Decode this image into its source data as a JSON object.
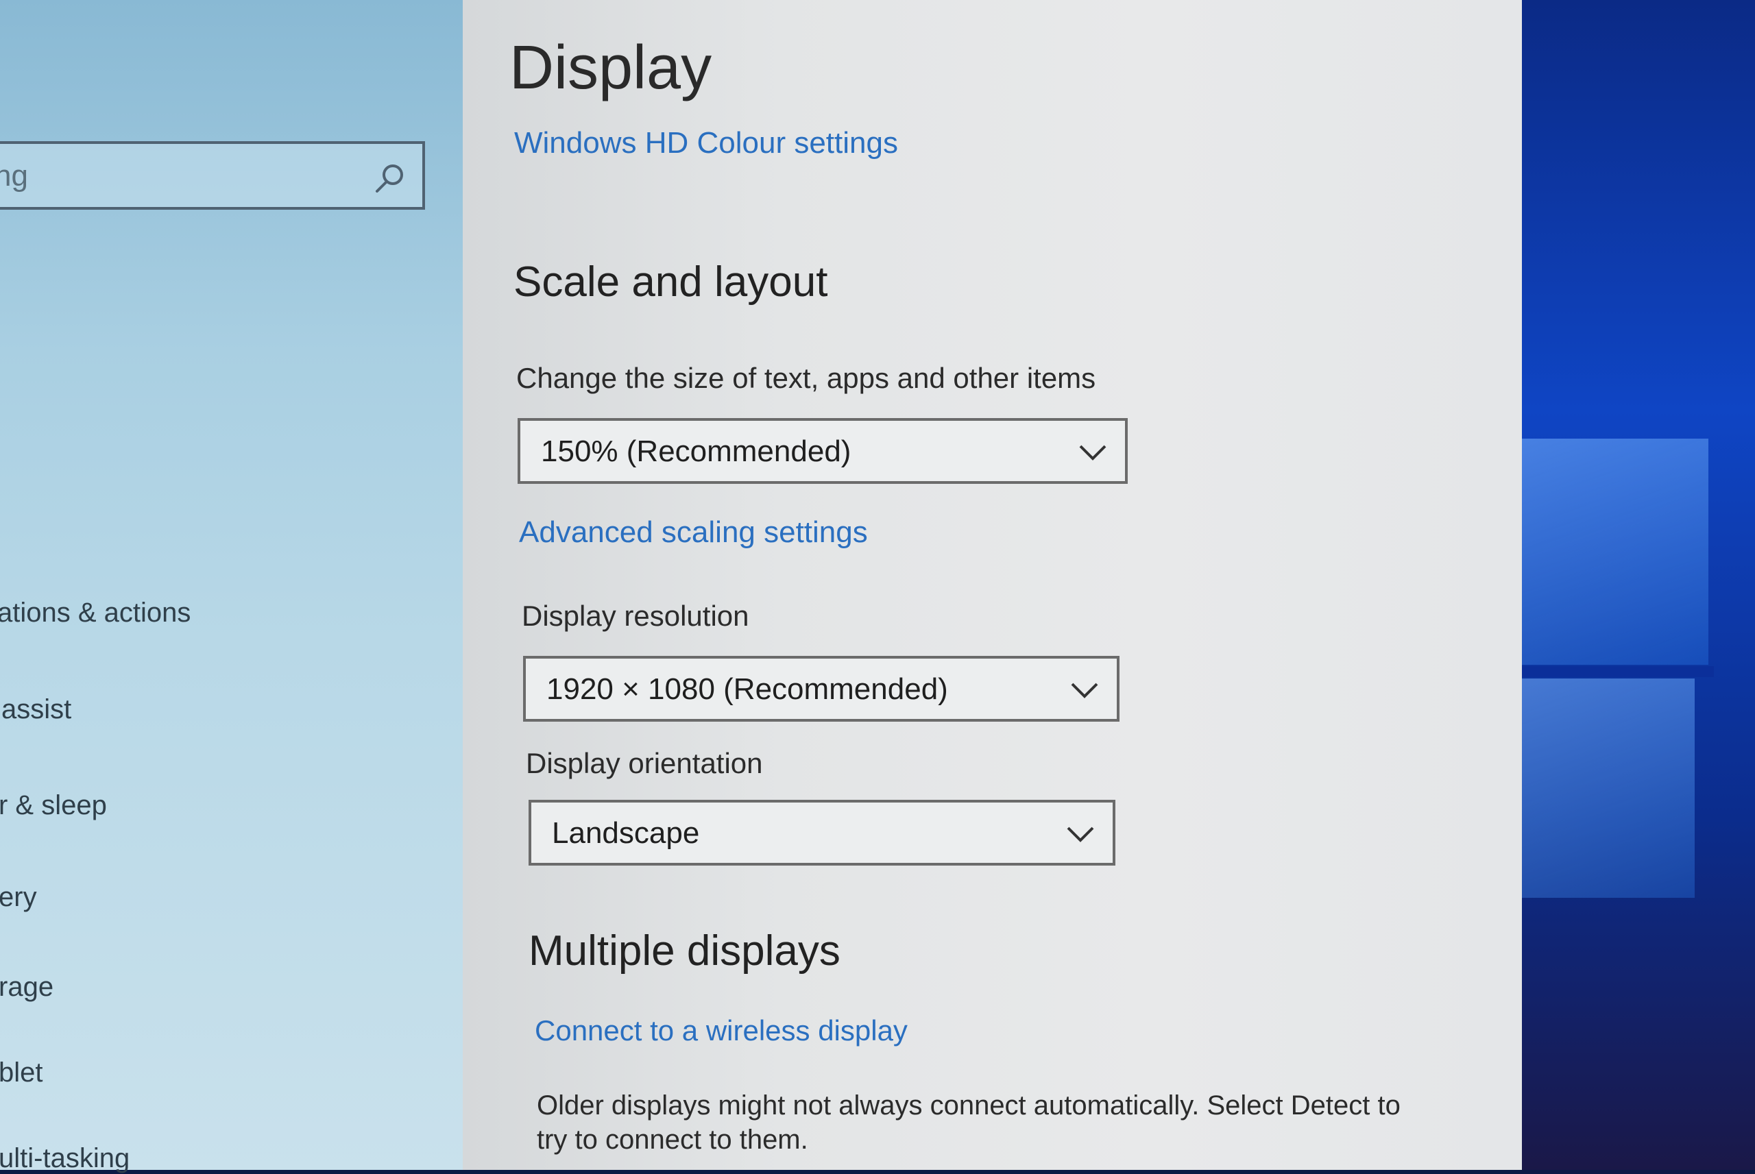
{
  "sidebar": {
    "search": {
      "value": "ng"
    },
    "items": [
      {
        "label": "ations & actions"
      },
      {
        "label": " assist"
      },
      {
        "label": "r & sleep"
      },
      {
        "label": "ery"
      },
      {
        "label": "rage"
      },
      {
        "label": "blet"
      },
      {
        "label": "ulti-tasking"
      }
    ]
  },
  "main": {
    "title": "Display",
    "hd_colour_link": "Windows HD Colour settings",
    "scale_section": {
      "heading": "Scale and layout",
      "size_label": "Change the size of text, apps and other items",
      "size_value": "150% (Recommended)",
      "advanced_link": "Advanced scaling settings",
      "resolution_label": "Display resolution",
      "resolution_value": "1920 × 1080 (Recommended)",
      "orientation_label": "Display orientation",
      "orientation_value": "Landscape"
    },
    "multiple_displays": {
      "heading": "Multiple displays",
      "wireless_link": "Connect to a wireless display",
      "detect_text": "Older displays might not always connect automatically. Select Detect to try to connect to them."
    }
  },
  "icons": {
    "search": "search-icon",
    "dropdown": "chevron-down-icon"
  },
  "colors": {
    "link": "#2a6fc0",
    "sidebar_bg": "#a9cfe2",
    "content_bg": "#e5e7e8",
    "wallpaper": "#0f45c4"
  }
}
